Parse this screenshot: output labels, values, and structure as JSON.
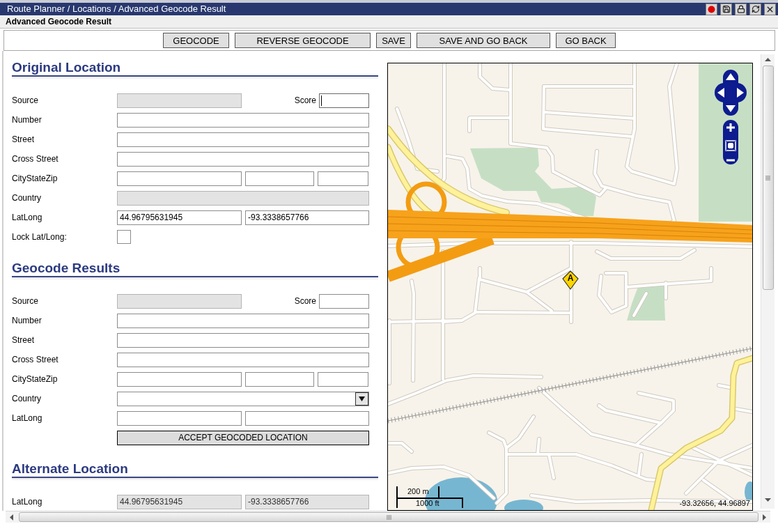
{
  "window": {
    "title": "Route Planner / Locations / Advanced Geocode Result"
  },
  "header": {
    "title": "Advanced Geocode Result"
  },
  "toolbar": {
    "buttons": [
      {
        "label": "GEOCODE"
      },
      {
        "label": "REVERSE GEOCODE"
      },
      {
        "label": "SAVE"
      },
      {
        "label": "SAVE AND GO BACK"
      },
      {
        "label": "GO BACK"
      }
    ]
  },
  "sections": [
    {
      "title": "Original Location",
      "rows": [
        {
          "kind": "source",
          "label": "Source",
          "field": {
            "disabled": true
          },
          "score": {
            "label": "Score",
            "focused": true
          }
        },
        {
          "kind": "text",
          "label": "Number",
          "field": {
            "disabled": false
          }
        },
        {
          "kind": "text",
          "label": "Street",
          "field": {
            "disabled": false
          }
        },
        {
          "kind": "text",
          "label": "Cross Street",
          "field": {
            "disabled": false
          }
        },
        {
          "kind": "triple",
          "label": "CityStateZip",
          "fields": [
            {
              "disabled": false
            },
            {
              "disabled": false
            },
            {
              "disabled": false
            }
          ]
        },
        {
          "kind": "text",
          "label": "Country",
          "field": {
            "disabled": true
          }
        },
        {
          "kind": "pair",
          "label": "LatLong",
          "fields": [
            {
              "value": "44.96795631945",
              "disabled": false
            },
            {
              "value": "-93.3338657766",
              "disabled": false
            }
          ]
        },
        {
          "kind": "checkbox",
          "label": "Lock Lat/Long:",
          "checked": false
        }
      ]
    },
    {
      "title": "Geocode Results",
      "rows": [
        {
          "kind": "source",
          "label": "Source",
          "field": {
            "disabled": true
          },
          "score": {
            "label": "Score",
            "focused": false
          }
        },
        {
          "kind": "text",
          "label": "Number",
          "field": {
            "disabled": false
          }
        },
        {
          "kind": "text",
          "label": "Street",
          "field": {
            "disabled": false
          }
        },
        {
          "kind": "text",
          "label": "Cross Street",
          "field": {
            "disabled": false
          }
        },
        {
          "kind": "triple",
          "label": "CityStateZip",
          "fields": [
            {
              "disabled": false
            },
            {
              "disabled": false
            },
            {
              "disabled": false
            }
          ]
        },
        {
          "kind": "select",
          "label": "Country"
        },
        {
          "kind": "pair",
          "label": "LatLong",
          "fields": [
            {
              "disabled": false
            },
            {
              "disabled": false
            }
          ]
        },
        {
          "kind": "button",
          "button": "ACCEPT GEOCODED LOCATION"
        }
      ]
    },
    {
      "title": "Alternate Location",
      "rows": [
        {
          "kind": "pair",
          "label": "LatLong",
          "fields": [
            {
              "value": "44.96795631945",
              "disabled": true
            },
            {
              "value": "-93.3338657766",
              "disabled": true
            }
          ]
        }
      ]
    }
  ],
  "map": {
    "marker": {
      "label": "A"
    },
    "scale": {
      "metric": "200 m",
      "imperial": "1000 ft"
    },
    "coordinates": "-93.32656, 44.96897"
  }
}
